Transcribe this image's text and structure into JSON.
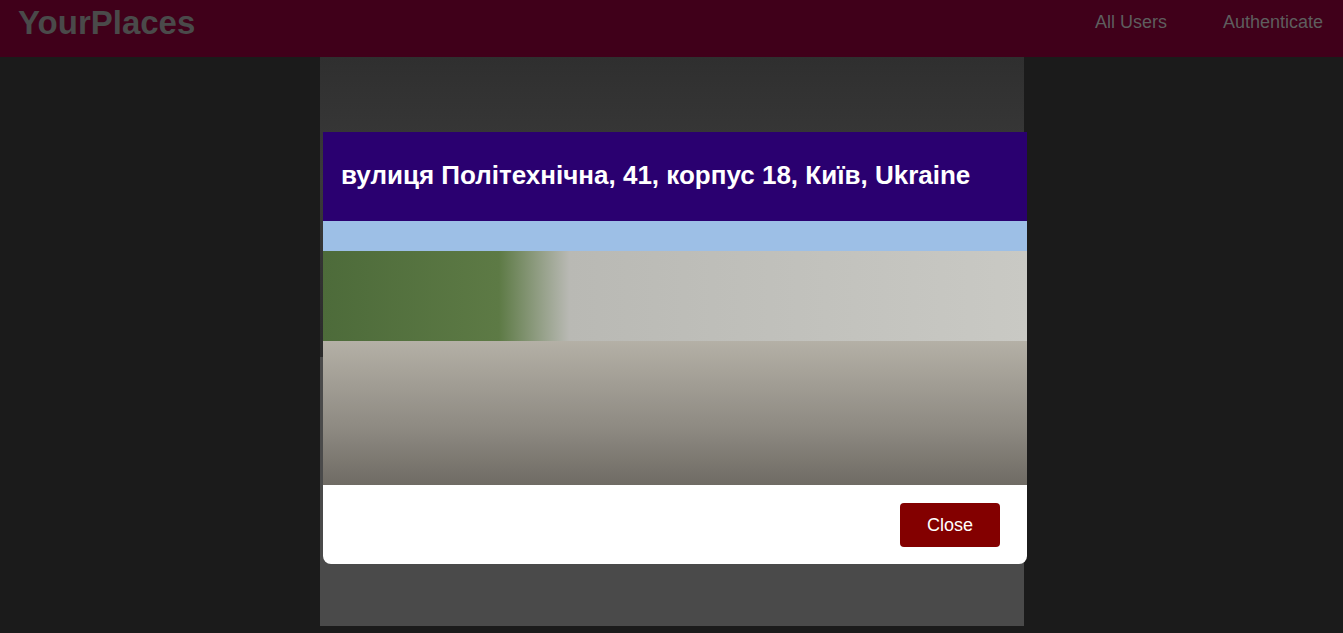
{
  "header": {
    "logo": "YourPlaces",
    "nav": [
      {
        "label": "All Users"
      },
      {
        "label": "Authenticate"
      }
    ]
  },
  "modal": {
    "title": "вулиця Політехнічна, 41, корпус 18, Київ, Ukraine",
    "buttons": [
      "Close"
    ]
  }
}
